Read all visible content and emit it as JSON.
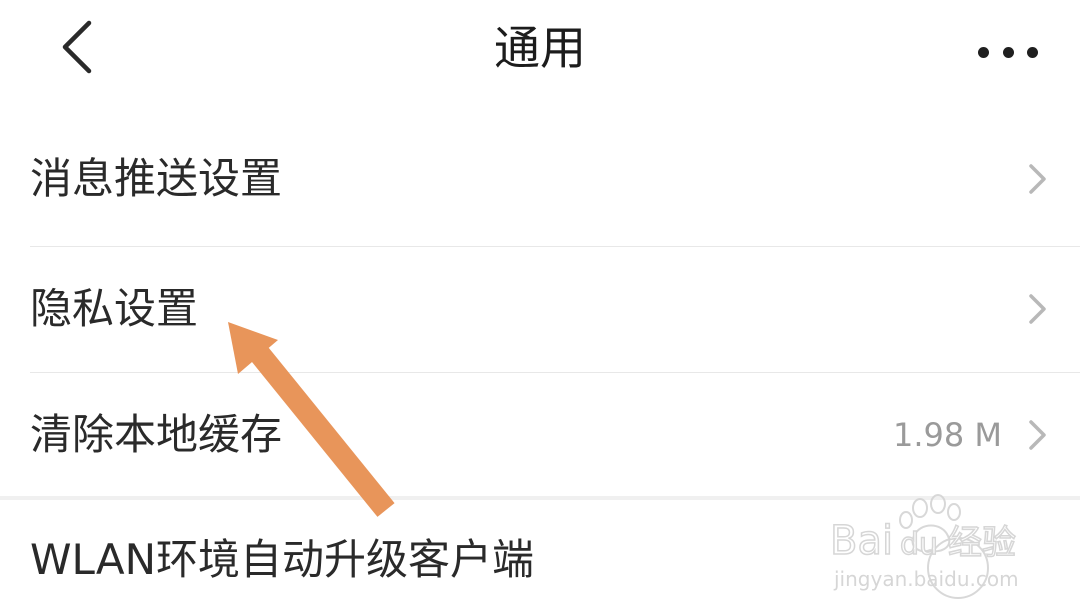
{
  "header": {
    "title": "通用",
    "back_icon": "chevron-left-icon",
    "more_icon": "more-dots-icon"
  },
  "settings": {
    "items": [
      {
        "label": "消息推送设置",
        "value": "",
        "icon": "chevron-right-icon"
      },
      {
        "label": "隐私设置",
        "value": "",
        "icon": "chevron-right-icon"
      },
      {
        "label": "清除本地缓存",
        "value": "1.98 M",
        "icon": "chevron-right-icon"
      },
      {
        "label": "WLAN环境自动升级客户端",
        "value": ""
      }
    ]
  },
  "annotation": {
    "color": "#E8955A",
    "points_to": "隐私设置"
  },
  "watermark": {
    "brand": "Baidu经验",
    "url": "jingyan.baidu.com"
  }
}
